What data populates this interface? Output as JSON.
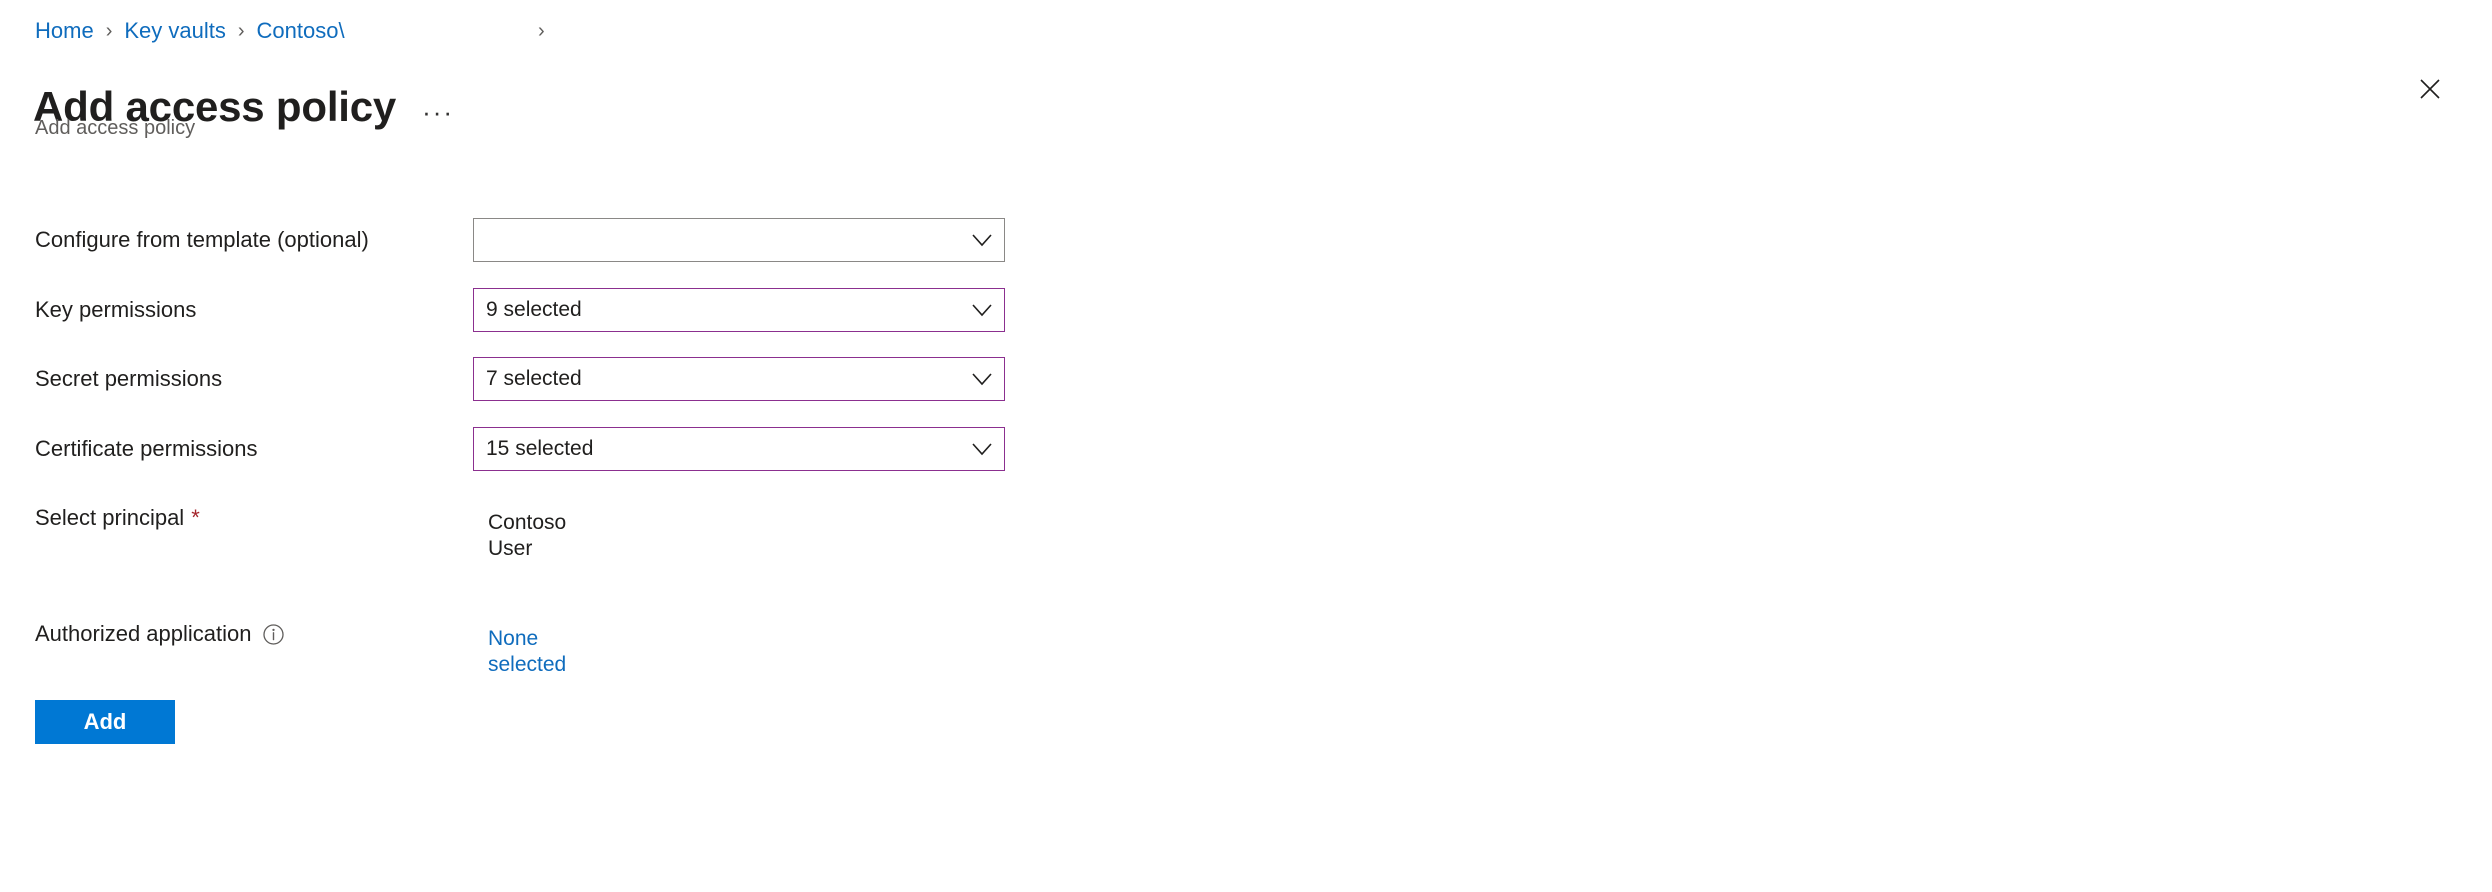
{
  "breadcrumb": {
    "items": [
      {
        "label": "Home",
        "truncated": false
      },
      {
        "label": "Key vaults",
        "truncated": false
      },
      {
        "label": "Contoso\\",
        "truncated": true
      }
    ],
    "separator": "›",
    "trailing_separator": "›",
    "link_color": "#0f6cbd"
  },
  "header": {
    "title": "Add access policy",
    "subtitle": "Add access policy",
    "overflow_menu": "···",
    "close_icon": "close-icon"
  },
  "form": {
    "rows": [
      {
        "label": "Configure from template (optional)",
        "control": "dropdown",
        "value": "",
        "required": false,
        "selected_state": false
      },
      {
        "label": "Key permissions",
        "control": "dropdown",
        "value": "9 selected",
        "required": false,
        "selected_state": true
      },
      {
        "label": "Secret permissions",
        "control": "dropdown",
        "value": "7 selected",
        "required": false,
        "selected_state": true
      },
      {
        "label": "Certificate permissions",
        "control": "dropdown",
        "value": "15 selected",
        "required": false,
        "selected_state": true
      },
      {
        "label": "Select principal",
        "control": "static-text",
        "value": "Contoso User",
        "required": true,
        "required_marker": "*"
      },
      {
        "label": "Authorized application",
        "control": "link",
        "value": "None selected",
        "required": false,
        "info_icon": "info-icon"
      }
    ]
  },
  "actions": {
    "add_label": "Add"
  },
  "colors": {
    "accent_blue": "#0078d4",
    "link_blue": "#0f6cbd",
    "selected_border_purple": "#8b2f8f",
    "default_border_gray": "#8a8886",
    "required_red": "#a4262c",
    "subtitle_gray": "#605e5c"
  }
}
